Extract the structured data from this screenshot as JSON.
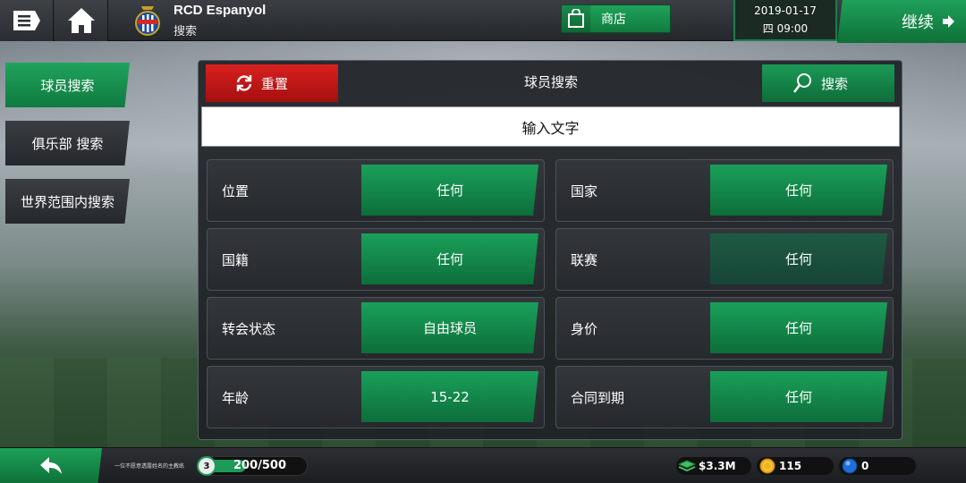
{
  "topbar": {
    "club_name": "RCD Espanyol",
    "page_subtitle": "搜索",
    "shop_label": "商店",
    "date": "2019-01-17",
    "day_time": "四 09:00",
    "continue_label": "继续"
  },
  "sidebar": {
    "items": [
      {
        "label": "球员搜索",
        "active": true
      },
      {
        "label": "俱乐部 搜索",
        "active": false
      },
      {
        "label": "世界范围内搜索",
        "active": false
      }
    ]
  },
  "panel": {
    "reset_label": "重置",
    "title": "球员搜索",
    "search_label": "搜索",
    "input_placeholder": "输入文字",
    "filters_left": [
      {
        "label": "位置",
        "value": "任何"
      },
      {
        "label": "国籍",
        "value": "任何"
      },
      {
        "label": "转会状态",
        "value": "自由球员"
      },
      {
        "label": "年龄",
        "value": "15-22"
      }
    ],
    "filters_right": [
      {
        "label": "国家",
        "value": "任何"
      },
      {
        "label": "联赛",
        "value": "任何"
      },
      {
        "label": "身价",
        "value": "任何"
      },
      {
        "label": "合同到期",
        "value": "任何"
      }
    ]
  },
  "bottombar": {
    "manager_name": "一位不愿意透露姓名的主教练",
    "level": "3",
    "xp_text": "200/500",
    "xp_fraction": 0.4,
    "money": "$3.3M",
    "coins": "115",
    "gems": "0"
  },
  "colors": {
    "accent_green": "#1aa05a",
    "reset_red": "#d8211f"
  }
}
